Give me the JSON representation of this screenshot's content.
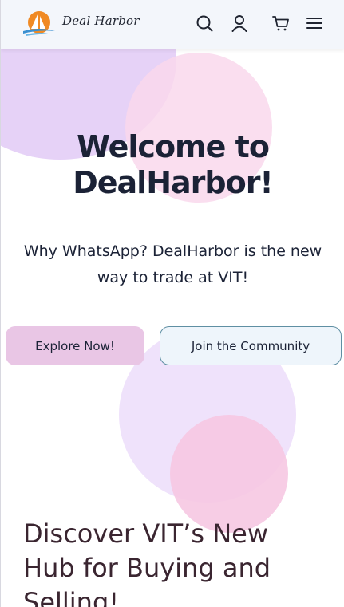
{
  "header": {
    "brand": "Deal Harbor",
    "logo_icon": "sailboat-sunset-logo",
    "icons": [
      "search-icon",
      "user-icon",
      "cart-icon",
      "menu-icon"
    ]
  },
  "hero": {
    "title_line1": "Welcome to",
    "title_line2": "DealHarbor!",
    "subtitle_line1": "Why WhatsApp? DealHarbor is the new",
    "subtitle_line2": "way to trade at VIT!",
    "explore_label": "Explore Now!",
    "join_label": "Join the Community"
  },
  "section": {
    "title_line1": "Discover VIT’s New",
    "title_line2": "Hub for Buying and",
    "title_line3": "Selling!"
  },
  "colors": {
    "header_bg": "#f3f6fb",
    "text_dark": "#1b2236",
    "explore_bg": "#e9c6e5",
    "join_border": "#5f8fa3",
    "logo_orange": "#f08a24",
    "logo_blue": "#3a8fd0"
  }
}
